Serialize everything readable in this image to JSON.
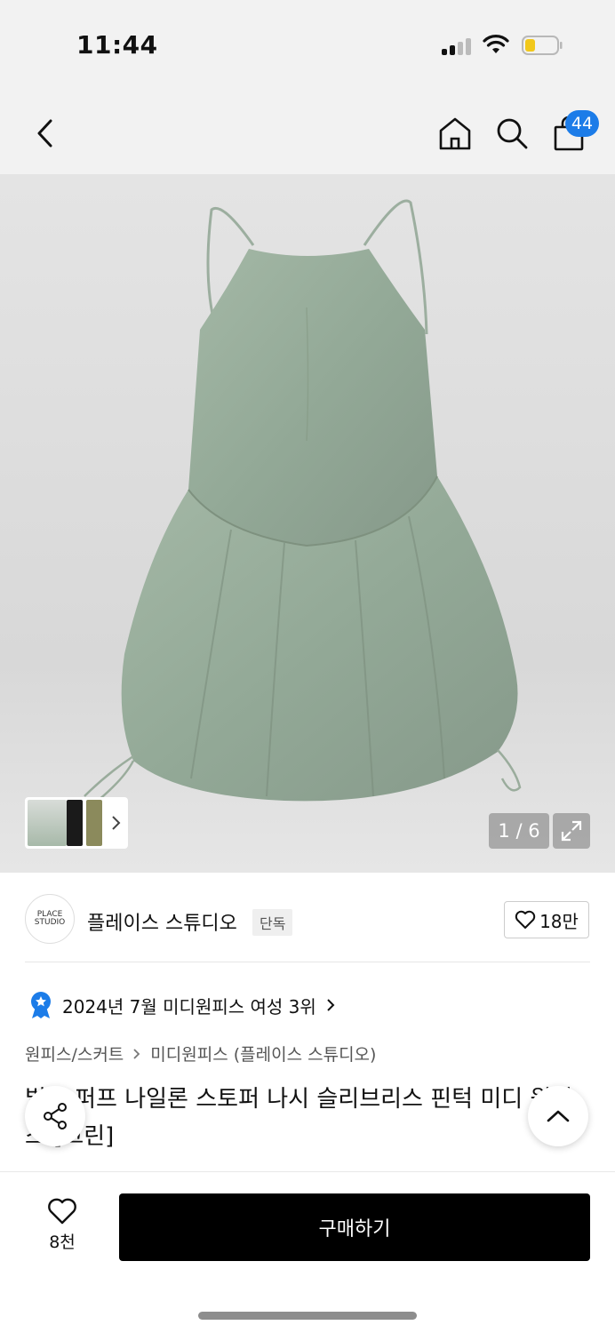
{
  "status_bar": {
    "time": "11:44"
  },
  "header": {
    "cart_count": "44"
  },
  "gallery": {
    "counter": "1 / 6"
  },
  "brand": {
    "logo_text": "PLACE STUDIO",
    "name": "플레이스 스튜디오",
    "tag": "단독",
    "likes": "18만"
  },
  "ranking": {
    "text": "2024년 7월 미디원피스 여성 3위"
  },
  "breadcrumb": {
    "level1": "원피스/스커트",
    "level2": "미디원피스 (플레이스 스튜디오)"
  },
  "product": {
    "title": "벌룬 퍼프 나일론 스토퍼 나시 슬리브리스 핀턱 미디 원피스 [그린]"
  },
  "bottom_bar": {
    "wish_count": "8천",
    "buy_label": "구매하기"
  },
  "colors": {
    "accent_blue": "#1c7ce8",
    "dress_green": "#95ab98"
  }
}
